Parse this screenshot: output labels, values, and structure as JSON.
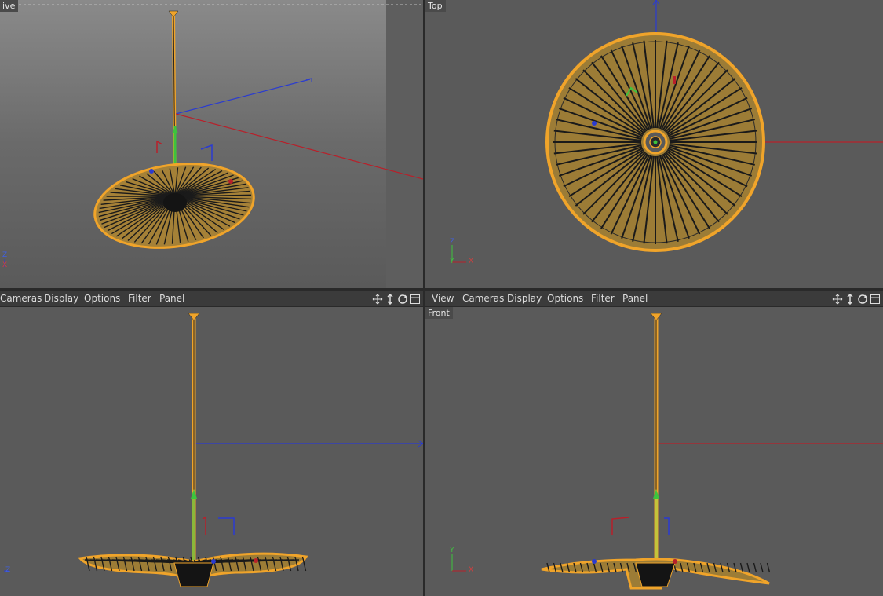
{
  "viewports": {
    "perspective": {
      "label": "ive",
      "axis_z": "Z",
      "axis_x": "X"
    },
    "top": {
      "label": "Top",
      "axis_z": "Z",
      "axis_y": "Y",
      "axis_x": "X"
    },
    "right": {
      "axis_z": "Z"
    },
    "front": {
      "label": "Front",
      "axis_y": "Y",
      "axis_x": "X"
    }
  },
  "toolbar_left": {
    "items": [
      "Cameras",
      "Display",
      "Options",
      "Filter",
      "Panel"
    ]
  },
  "toolbar_right": {
    "items": [
      "View",
      "Cameras",
      "Display",
      "Options",
      "Filter",
      "Panel"
    ]
  },
  "toolbar_icons": [
    "move-view-icon",
    "dolly-view-icon",
    "rotate-view-icon",
    "maximize-view-icon"
  ],
  "colors": {
    "viewport_bg": "#5a5a5a",
    "wire_orange": "#f0a42a",
    "axis_x": "#b8202a",
    "axis_y": "#3dc43d",
    "axis_z": "#2a3bd1"
  }
}
